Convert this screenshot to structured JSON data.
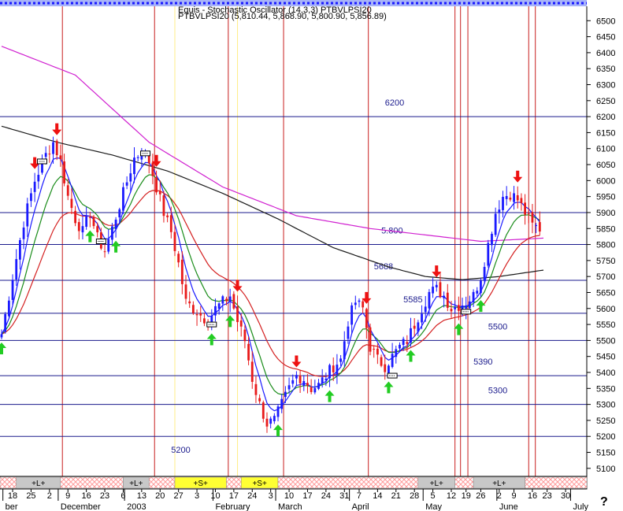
{
  "header": {
    "line1": "Equis - Stochastic Oscillator (14,3,3) PTBVLPSI20",
    "line2": "PTBVLPSI20 (5,810.44, 5,868.90, 5,800.90, 5,856.89)"
  },
  "help_symbol": "?",
  "chart_data": {
    "type": "candlestick",
    "y_range": [
      5075,
      6545
    ],
    "y_ticks": [
      5100,
      5150,
      5200,
      5250,
      5300,
      5350,
      5400,
      5450,
      5500,
      5550,
      5600,
      5650,
      5700,
      5750,
      5800,
      5850,
      5900,
      5950,
      6000,
      6050,
      6100,
      6150,
      6200,
      6250,
      6300,
      6350,
      6400,
      6450,
      6500
    ],
    "x_range": [
      0,
      147
    ],
    "x_ticks": [
      {
        "x": 3,
        "label": "18"
      },
      {
        "x": 8,
        "label": "25"
      },
      {
        "x": 13,
        "label": "2"
      },
      {
        "x": 18,
        "label": "9"
      },
      {
        "x": 23,
        "label": "16"
      },
      {
        "x": 28,
        "label": "23"
      },
      {
        "x": 33,
        "label": "6"
      },
      {
        "x": 38,
        "label": "13"
      },
      {
        "x": 43,
        "label": "20"
      },
      {
        "x": 48,
        "label": "27"
      },
      {
        "x": 53,
        "label": "3"
      },
      {
        "x": 58,
        "label": "10"
      },
      {
        "x": 63,
        "label": "17"
      },
      {
        "x": 68,
        "label": "24"
      },
      {
        "x": 73,
        "label": "3"
      },
      {
        "x": 78,
        "label": "10"
      },
      {
        "x": 83,
        "label": "17"
      },
      {
        "x": 88,
        "label": "24"
      },
      {
        "x": 93,
        "label": "31"
      },
      {
        "x": 97,
        "label": "7"
      },
      {
        "x": 102,
        "label": "14"
      },
      {
        "x": 107,
        "label": "21"
      },
      {
        "x": 112,
        "label": "28"
      },
      {
        "x": 117,
        "label": "5"
      },
      {
        "x": 122,
        "label": "12"
      },
      {
        "x": 126,
        "label": "19"
      },
      {
        "x": 130,
        "label": "26"
      },
      {
        "x": 135,
        "label": "2"
      },
      {
        "x": 139,
        "label": "9"
      },
      {
        "x": 144,
        "label": "16"
      },
      {
        "x": 148,
        "label": "23"
      },
      {
        "x": 153,
        "label": "30"
      }
    ],
    "month_labels": [
      {
        "x": 1,
        "label": "ber"
      },
      {
        "x": 16,
        "label": "December"
      },
      {
        "x": 34,
        "label": "2003"
      },
      {
        "x": 58,
        "label": "February"
      },
      {
        "x": 75,
        "label": "March"
      },
      {
        "x": 95,
        "label": "April"
      },
      {
        "x": 115,
        "label": "May"
      },
      {
        "x": 135,
        "label": "June"
      },
      {
        "x": 155,
        "label": "July"
      }
    ],
    "horizontal_levels": [
      {
        "value": 6200,
        "label": "6200",
        "label_x": 104
      },
      {
        "value": 5900,
        "label": "",
        "label_x": 0
      },
      {
        "value": 5800,
        "label": "5.800",
        "label_x": 103
      },
      {
        "value": 5688,
        "label": "5688",
        "label_x": 101
      },
      {
        "value": 5585,
        "label": "5585",
        "label_x": 109
      },
      {
        "value": 5500,
        "label": "5500",
        "label_x": 132
      },
      {
        "value": 5390,
        "label": "5390",
        "label_x": 128
      },
      {
        "value": 5300,
        "label": "5300",
        "label_x": 132
      },
      {
        "value": 5200,
        "label": "5200",
        "label_x": 46
      }
    ],
    "vertical_red": [
      16.5,
      41.5,
      61.5,
      76.5,
      99.5,
      123,
      124.5,
      126.5,
      143,
      144.8
    ],
    "vertical_yellow": [
      47,
      64
    ],
    "bands": [
      {
        "start": 0,
        "end": 4,
        "label": "",
        "style": "hatch"
      },
      {
        "start": 4,
        "end": 16,
        "label": "+L+",
        "style": "gray"
      },
      {
        "start": 16,
        "end": 33,
        "label": "",
        "style": "hatch"
      },
      {
        "start": 33,
        "end": 40,
        "label": "+L+",
        "style": "gray"
      },
      {
        "start": 40,
        "end": 47,
        "label": "",
        "style": "hatch"
      },
      {
        "start": 47,
        "end": 61,
        "label": "+S+",
        "style": "yellow"
      },
      {
        "start": 61,
        "end": 65,
        "label": "",
        "style": "hatch"
      },
      {
        "start": 65,
        "end": 75,
        "label": "+S+",
        "style": "yellow"
      },
      {
        "start": 75,
        "end": 113,
        "label": "",
        "style": "hatch"
      },
      {
        "start": 113,
        "end": 123,
        "label": "+L+",
        "style": "gray"
      },
      {
        "start": 123,
        "end": 128,
        "label": "",
        "style": "hatch"
      },
      {
        "start": 128,
        "end": 142,
        "label": "+L+",
        "style": "gray"
      },
      {
        "start": 142,
        "end": 147,
        "label": "",
        "style": "hatch"
      }
    ],
    "close_anchors": [
      [
        0,
        5520
      ],
      [
        3,
        5700
      ],
      [
        6,
        5870
      ],
      [
        9,
        6000
      ],
      [
        12,
        6080
      ],
      [
        14,
        6120
      ],
      [
        16,
        6060
      ],
      [
        18,
        5950
      ],
      [
        20,
        5880
      ],
      [
        22,
        5840
      ],
      [
        24,
        5900
      ],
      [
        26,
        5820
      ],
      [
        28,
        5780
      ],
      [
        30,
        5850
      ],
      [
        33,
        5960
      ],
      [
        36,
        6070
      ],
      [
        38,
        6090
      ],
      [
        40,
        6060
      ],
      [
        42,
        5980
      ],
      [
        44,
        5900
      ],
      [
        46,
        5840
      ],
      [
        48,
        5740
      ],
      [
        50,
        5620
      ],
      [
        52,
        5600
      ],
      [
        54,
        5580
      ],
      [
        56,
        5560
      ],
      [
        58,
        5600
      ],
      [
        60,
        5620
      ],
      [
        62,
        5640
      ],
      [
        64,
        5560
      ],
      [
        66,
        5500
      ],
      [
        68,
        5380
      ],
      [
        70,
        5300
      ],
      [
        72,
        5240
      ],
      [
        74,
        5250
      ],
      [
        76,
        5300
      ],
      [
        78,
        5350
      ],
      [
        80,
        5390
      ],
      [
        82,
        5380
      ],
      [
        84,
        5350
      ],
      [
        86,
        5360
      ],
      [
        88,
        5390
      ],
      [
        90,
        5420
      ],
      [
        92,
        5440
      ],
      [
        94,
        5560
      ],
      [
        96,
        5620
      ],
      [
        98,
        5600
      ],
      [
        100,
        5480
      ],
      [
        102,
        5440
      ],
      [
        104,
        5420
      ],
      [
        106,
        5450
      ],
      [
        108,
        5480
      ],
      [
        110,
        5500
      ],
      [
        112,
        5550
      ],
      [
        114,
        5600
      ],
      [
        116,
        5650
      ],
      [
        118,
        5660
      ],
      [
        120,
        5640
      ],
      [
        122,
        5600
      ],
      [
        124,
        5610
      ],
      [
        126,
        5620
      ],
      [
        128,
        5640
      ],
      [
        130,
        5700
      ],
      [
        132,
        5800
      ],
      [
        134,
        5900
      ],
      [
        136,
        5950
      ],
      [
        138,
        5960
      ],
      [
        140,
        5940
      ],
      [
        142,
        5900
      ],
      [
        144,
        5860
      ],
      [
        146,
        5850
      ]
    ],
    "sma200_anchors": [
      [
        0,
        6420
      ],
      [
        20,
        6330
      ],
      [
        40,
        6120
      ],
      [
        60,
        5980
      ],
      [
        80,
        5890
      ],
      [
        100,
        5850
      ],
      [
        115,
        5830
      ],
      [
        130,
        5810
      ],
      [
        147,
        5820
      ]
    ],
    "sma100_anchors": [
      [
        0,
        6170
      ],
      [
        15,
        6120
      ],
      [
        30,
        6080
      ],
      [
        45,
        6030
      ],
      [
        60,
        5960
      ],
      [
        75,
        5880
      ],
      [
        90,
        5790
      ],
      [
        105,
        5730
      ],
      [
        115,
        5700
      ],
      [
        125,
        5690
      ],
      [
        135,
        5700
      ],
      [
        147,
        5720
      ]
    ],
    "arrows": [
      {
        "x": 9,
        "type": "sell"
      },
      {
        "x": 15,
        "type": "sell"
      },
      {
        "x": 42,
        "type": "sell"
      },
      {
        "x": 64,
        "type": "sell"
      },
      {
        "x": 80,
        "type": "sell"
      },
      {
        "x": 99,
        "type": "sell"
      },
      {
        "x": 118,
        "type": "sell"
      },
      {
        "x": 140,
        "type": "sell"
      },
      {
        "x": 0,
        "type": "buy"
      },
      {
        "x": 24,
        "type": "buy"
      },
      {
        "x": 31,
        "type": "buy"
      },
      {
        "x": 57,
        "type": "buy"
      },
      {
        "x": 62,
        "type": "buy"
      },
      {
        "x": 75,
        "type": "buy"
      },
      {
        "x": 89,
        "type": "buy"
      },
      {
        "x": 105,
        "type": "buy"
      },
      {
        "x": 111,
        "type": "buy"
      },
      {
        "x": 124,
        "type": "buy"
      },
      {
        "x": 130,
        "type": "buy"
      }
    ],
    "exit_markers": [
      {
        "x": 11,
        "value": 6060
      },
      {
        "x": 27,
        "value": 5810
      },
      {
        "x": 39,
        "value": 6085
      },
      {
        "x": 57,
        "value": 5550
      },
      {
        "x": 106,
        "value": 5390
      },
      {
        "x": 126,
        "value": 5590
      }
    ]
  },
  "colors": {
    "price_up": "#1a1aff",
    "price_down": "#e81a1a",
    "fast_ma": "#1a1aff",
    "mid_ma": "#1a8c1a",
    "slow_ma": "#d42020",
    "sma100": "#1a1a1a",
    "sma200": "#d020d0",
    "level_line": "#1a1a8c",
    "signal_line": "#c81e1e",
    "yellow_line": "#ffee88",
    "buy_arrow": "#22cc22",
    "sell_arrow": "#ee1111"
  }
}
